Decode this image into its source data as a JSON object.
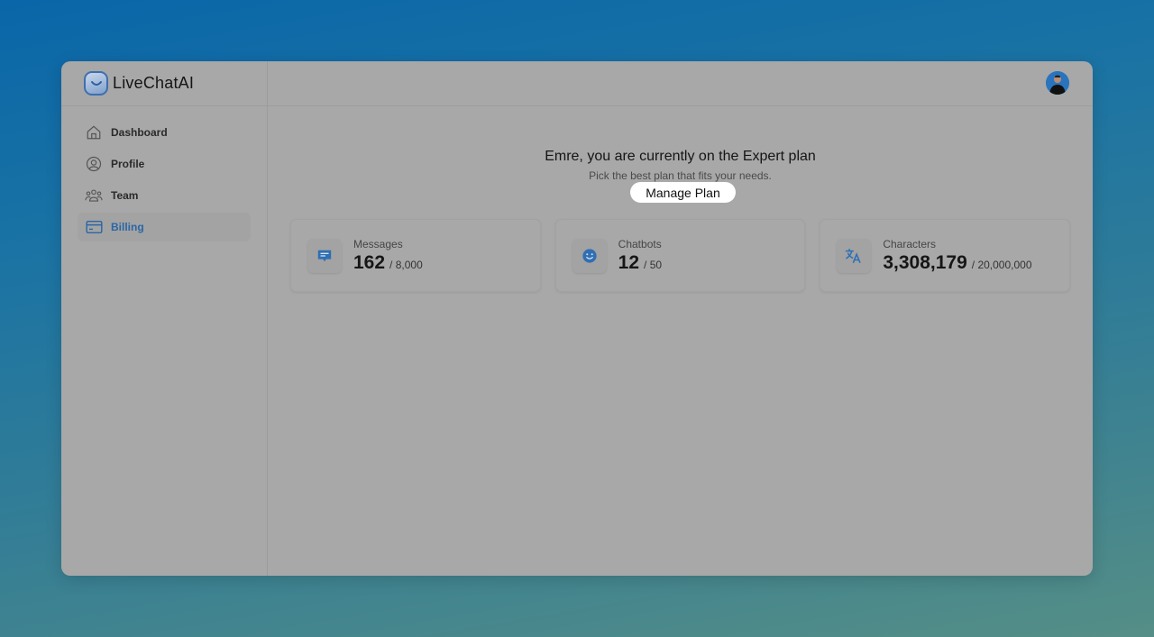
{
  "brand": {
    "name": "LiveChatAI"
  },
  "sidebar": {
    "items": [
      {
        "label": "Dashboard",
        "icon": "home-icon",
        "active": false
      },
      {
        "label": "Profile",
        "icon": "user-circle-icon",
        "active": false
      },
      {
        "label": "Team",
        "icon": "team-icon",
        "active": false
      },
      {
        "label": "Billing",
        "icon": "credit-card-icon",
        "active": true
      }
    ]
  },
  "header": {
    "avatar_alt": "User avatar"
  },
  "plan": {
    "title": "Emre, you are currently on the Expert plan",
    "subtitle": "Pick the best plan that fits your needs.",
    "manage_label": "Manage Plan"
  },
  "usage": [
    {
      "label": "Messages",
      "value": "162",
      "limit": "/ 8,000",
      "icon": "message-icon"
    },
    {
      "label": "Chatbots",
      "value": "12",
      "limit": "/ 50",
      "icon": "smiley-icon"
    },
    {
      "label": "Characters",
      "value": "3,308,179",
      "limit": "/ 20,000,000",
      "icon": "translate-icon"
    }
  ],
  "colors": {
    "accent": "#2b66a5",
    "icon_blue": "#2f6fb3"
  }
}
